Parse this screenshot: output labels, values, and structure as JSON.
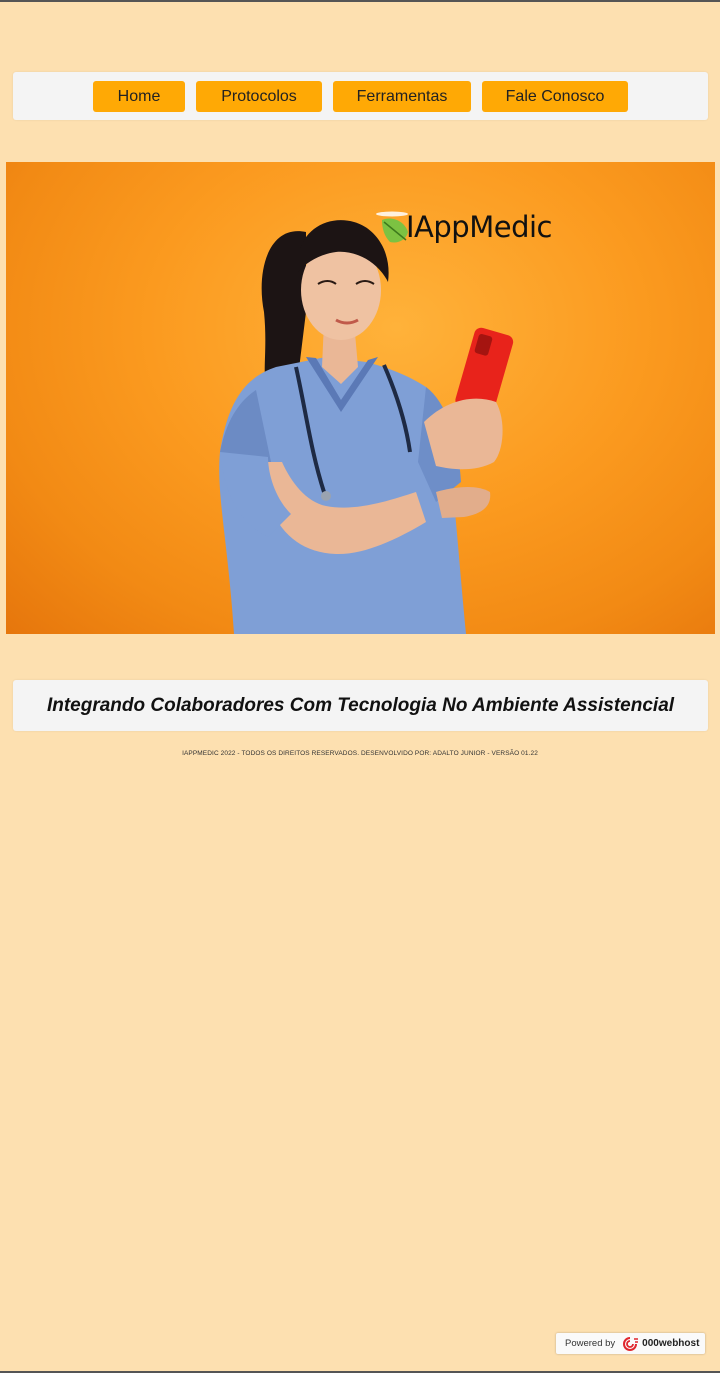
{
  "nav": {
    "items": [
      {
        "label": "Home"
      },
      {
        "label": "Protocolos"
      },
      {
        "label": "Ferramentas"
      },
      {
        "label": "Fale Conosco"
      }
    ]
  },
  "hero": {
    "logo_text": "IAppMedic"
  },
  "tagline": "Integrando Colaboradores Com Tecnologia No Ambiente Assistencial",
  "footer": {
    "copyright": "IAPPMEDIC 2022 - TODOS OS DIREITOS RESERVADOS. DESENVOLVIDO POR: ADALTO JUNIOR - VERSÃO 01.22"
  },
  "badge": {
    "label": "Powered by",
    "brand": "000webhost"
  },
  "colors": {
    "background": "#fde0b0",
    "nav_button": "#ffa905",
    "panel": "#f4f4f4",
    "hero_orange": "#fb9a1f",
    "scrubs": "#7f9fd6",
    "phone": "#e8231b"
  }
}
